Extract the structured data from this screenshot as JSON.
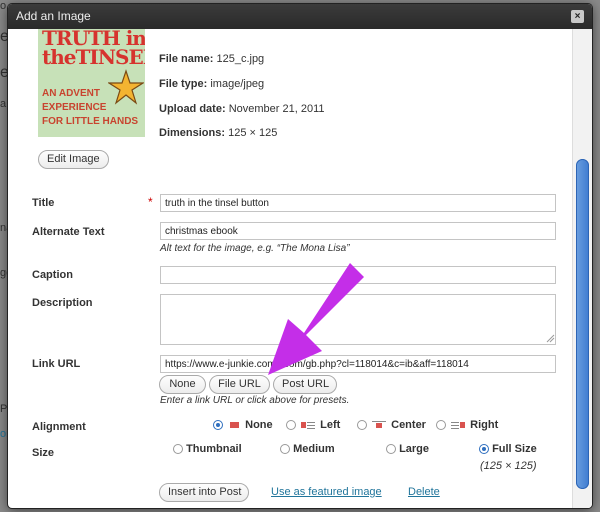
{
  "background": {
    "fragments": [
      "o",
      "ew",
      "e ,",
      "a",
      "nag",
      "ge i",
      "Pa",
      "on"
    ]
  },
  "dialog": {
    "title": "Add an Image",
    "close_symbol": "×"
  },
  "thumbnail": {
    "title_line1": "TRUTH in",
    "title_line2": "theTINSEL",
    "sub_line1": "AN ADVENT",
    "sub_line2": "EXPERIENCE",
    "sub_line3": "FOR LITTLE HANDS"
  },
  "file_info": {
    "file_name_label": "File name:",
    "file_name": "125_c.jpg",
    "file_type_label": "File type:",
    "file_type": "image/jpeg",
    "upload_date_label": "Upload date:",
    "upload_date": "November 21, 2011",
    "dimensions_label": "Dimensions:",
    "dimensions": "125 × 125"
  },
  "edit_image_label": "Edit Image",
  "fields": {
    "title_label": "Title",
    "required_mark": "*",
    "title_value": "truth in the tinsel button",
    "alt_label": "Alternate Text",
    "alt_value": "christmas ebook",
    "alt_hint": "Alt text for the image, e.g. “The Mona Lisa”",
    "caption_label": "Caption",
    "caption_value": "",
    "description_label": "Description",
    "description_value": "",
    "link_label": "Link URL",
    "link_value": "https://www.e-junkie.com/ecom/gb.php?cl=118014&c=ib&aff=118014",
    "link_buttons": [
      "None",
      "File URL",
      "Post URL"
    ],
    "link_hint": "Enter a link URL or click above for presets."
  },
  "alignment": {
    "label": "Alignment",
    "options": [
      "None",
      "Left",
      "Center",
      "Right"
    ],
    "selected": "None"
  },
  "size": {
    "label": "Size",
    "options": [
      "Thumbnail",
      "Medium",
      "Large",
      "Full Size"
    ],
    "selected": "Full Size",
    "full_size_dims": "(125 × 125)"
  },
  "actions": {
    "insert_label": "Insert into Post",
    "featured_label": "Use as featured image",
    "delete_label": "Delete"
  },
  "colors": {
    "annotation_arrow": "#c42ee8",
    "link": "#21759b",
    "scrollbar_thumb": "#3e7bd0"
  }
}
